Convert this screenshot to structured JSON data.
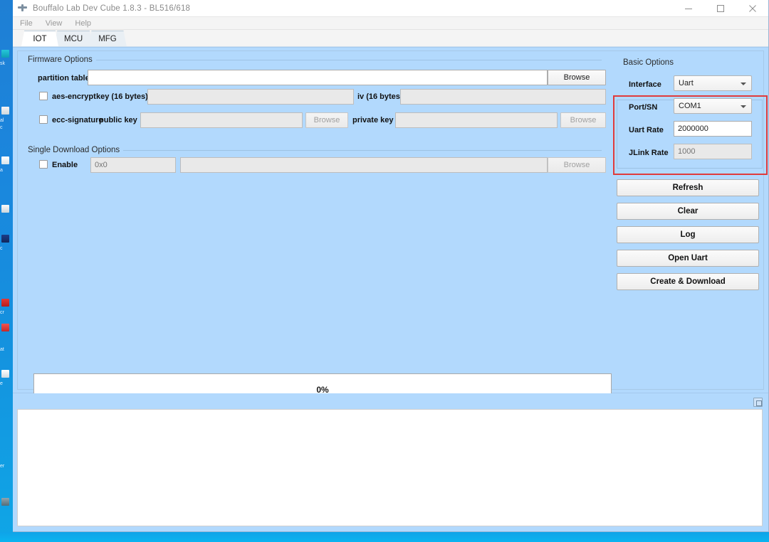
{
  "window": {
    "title": "Bouffalo Lab Dev Cube 1.8.3 - BL516/618",
    "app_icon": "tool-icon",
    "controls": {
      "minimize": "minimize-icon",
      "maximize": "maximize-icon",
      "close": "close-icon"
    }
  },
  "menubar": {
    "items": [
      {
        "label": "File"
      },
      {
        "label": "View"
      },
      {
        "label": "Help"
      }
    ]
  },
  "tabs": [
    {
      "label": "IOT",
      "active": true
    },
    {
      "label": "MCU",
      "active": false
    },
    {
      "label": "MFG",
      "active": false
    }
  ],
  "firmware_options": {
    "group_label": "Firmware Options",
    "partition_table": {
      "label": "partition table",
      "value": "",
      "placeholder": "",
      "browse_label": "Browse",
      "browse_enabled": true
    },
    "aes_encrypt": {
      "checkbox_label": "aes-encrypt",
      "checked": false,
      "key_label": "key (16 bytes)",
      "key_value": "",
      "iv_label": "iv (16 bytes)",
      "iv_value": ""
    },
    "ecc_signature": {
      "checkbox_label": "ecc-signature",
      "checked": false,
      "public_key_label": "public key",
      "public_key_value": "",
      "public_browse_label": "Browse",
      "private_key_label": "private key",
      "private_key_value": "",
      "private_browse_label": "Browse"
    }
  },
  "single_download_options": {
    "group_label": "Single Download Options",
    "enable_label": "Enable",
    "enabled": false,
    "address_value": "",
    "address_placeholder": "0x0",
    "file_value": "",
    "browse_label": "Browse"
  },
  "progress": {
    "percent_label": "0%",
    "value": 0
  },
  "basic_options": {
    "group_label": "Basic Options",
    "highlight_color": "#e03b3b",
    "fields": [
      {
        "label": "Interface",
        "value": "Uart",
        "type": "select",
        "enabled": true
      },
      {
        "label": "Port/SN",
        "value": "COM1",
        "type": "select",
        "enabled": true
      },
      {
        "label": "Uart Rate",
        "value": "2000000",
        "type": "text",
        "enabled": true
      },
      {
        "label": "JLink Rate",
        "value": "",
        "placeholder": "1000",
        "type": "text",
        "enabled": false
      }
    ]
  },
  "action_buttons": [
    {
      "label": "Refresh"
    },
    {
      "label": "Clear"
    },
    {
      "label": "Log"
    },
    {
      "label": "Open Uart"
    },
    {
      "label": "Create & Download"
    }
  ],
  "log_panel": {
    "content": "",
    "resize_icon": "restore-window-icon"
  },
  "colors": {
    "panel_background": "#b2d9fd",
    "desktop": "#1482d9",
    "accent_red": "#e03b3b"
  }
}
